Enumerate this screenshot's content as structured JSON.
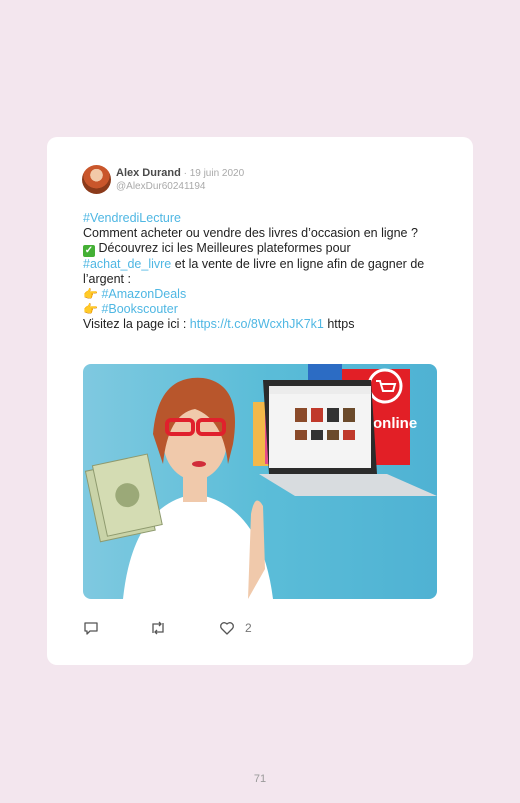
{
  "tweet": {
    "author_name": "Alex Durand",
    "separator": " · ",
    "date": "19 juin 2020",
    "handle": "@AlexDur60241194",
    "lines": {
      "hashtag": "#VendrediLecture",
      "question": "Comment acheter ou vendre des livres d’occasion en ligne ?",
      "discover": " Découvrez ici les Meilleures plateformes pour ",
      "hashtag2": "#achat_de_livre",
      "discover_end": " et la vente de livre en ligne afin de gagner de l’argent :",
      "deal1": "#AmazonDeals",
      "deal2": "#Bookscouter",
      "visit": "Visitez la page ici : ",
      "url": "https://t.co/8WcxhJK7k1",
      "url_suffix": " https"
    },
    "image": {
      "badge_text": "online"
    },
    "likes_count": "2"
  },
  "page": {
    "number": "71"
  },
  "colors": {
    "background": "#f3e6ee",
    "link": "#4fb7e3",
    "card": "#ffffff"
  }
}
